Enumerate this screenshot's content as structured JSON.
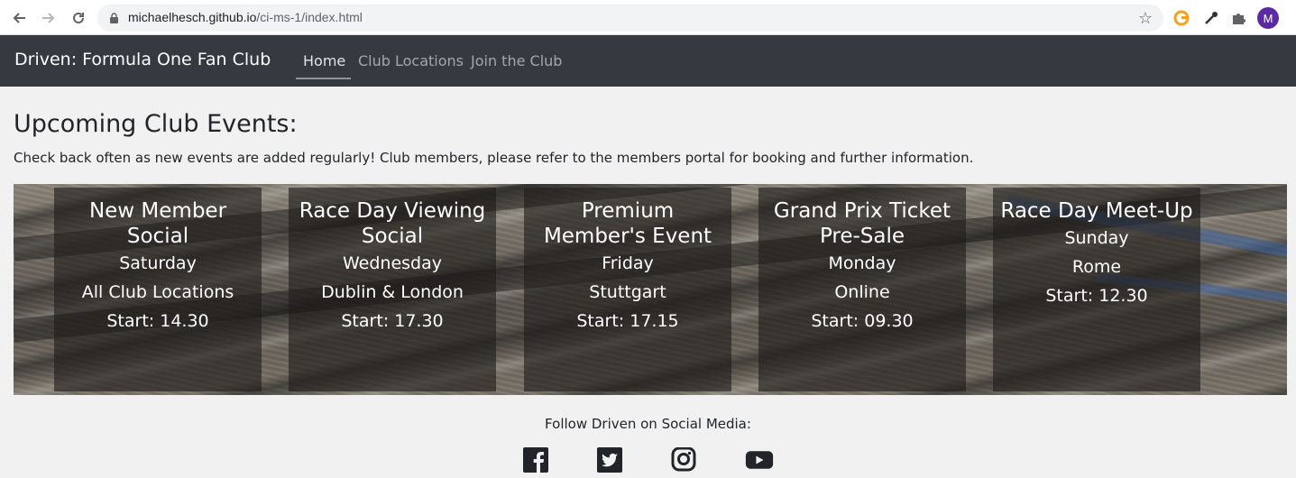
{
  "browser": {
    "url_host": "michaelhesch.github.io",
    "url_path": "/ci-ms-1/index.html",
    "profile_initial": "M"
  },
  "navbar": {
    "brand": "Driven: Formula One Fan Club",
    "links": [
      {
        "label": "Home",
        "active": true
      },
      {
        "label": "Club Locations",
        "active": false
      },
      {
        "label": "Join the Club",
        "active": false
      }
    ]
  },
  "main": {
    "title": "Upcoming Club Events:",
    "intro": "Check back often as new events are added regularly! Club members, please refer to the members portal for booking and further information."
  },
  "events": [
    {
      "title": "New Member Social",
      "day": "Saturday",
      "location": "All Club Locations",
      "start": "Start: 14.30"
    },
    {
      "title": "Race Day Viewing Social",
      "day": "Wednesday",
      "location": "Dublin & London",
      "start": "Start: 17.30"
    },
    {
      "title": "Premium Member's Event",
      "day": "Friday",
      "location": "Stuttgart",
      "start": "Start: 17.15"
    },
    {
      "title": "Grand Prix Ticket Pre-Sale",
      "day": "Monday",
      "location": "Online",
      "start": "Start: 09.30"
    },
    {
      "title": "Race Day Meet-Up",
      "day": "Sunday",
      "location": "Rome",
      "start": "Start: 12.30"
    }
  ],
  "footer": {
    "follow_text": "Follow Driven on Social Media:",
    "social_icons": [
      "facebook-icon",
      "twitter-icon",
      "instagram-icon",
      "youtube-icon"
    ]
  },
  "colors": {
    "navbar_bg": "#343a40",
    "page_bg": "#f1f1f1"
  }
}
